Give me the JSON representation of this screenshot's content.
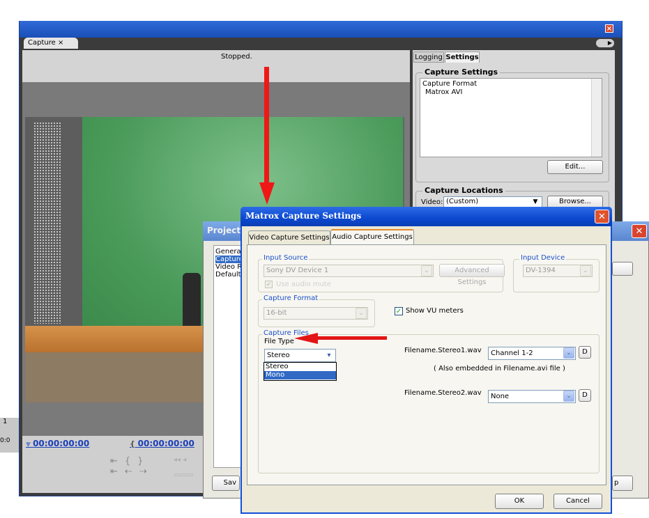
{
  "capture_panel": {
    "tab_label": "Capture",
    "tab_close": "×",
    "status": "Stopped.",
    "timecode_left": "00:00:00:00",
    "timecode_right": "00:00:00:00",
    "timecode_edge": "0:0",
    "edge_number": "1"
  },
  "settings_panel": {
    "tabs": [
      "Logging",
      "Settings"
    ],
    "capture_settings_title": "Capture Settings",
    "capture_format_label": "Capture Format",
    "capture_format_value": "Matrox AVI",
    "edit_button": "Edit...",
    "capture_locations_title": "Capture Locations",
    "video_label": "Video:",
    "video_value": "(Custom)",
    "browse_button": "Browse..."
  },
  "project_dialog": {
    "title": "Project",
    "list_items": [
      "General",
      "Capture",
      "Video R",
      "Default "
    ],
    "save_button": "Sav",
    "help_button": "p"
  },
  "matrox_dialog": {
    "title": "Matrox Capture Settings",
    "tabs": [
      "Video Capture Settings",
      "Audio Capture Settings"
    ],
    "input_source": {
      "label": "Input Source",
      "value": "Sony DV Device 1",
      "advanced_button": "Advanced Settings",
      "hidden_option": "Use audio mute"
    },
    "input_device": {
      "label": "Input Device",
      "value": "DV-1394"
    },
    "capture_format": {
      "label": "Capture Format",
      "value": "16-bit"
    },
    "show_vu": "Show VU meters",
    "capture_files": {
      "label": "Capture Files",
      "file_type_label": "File Type",
      "file_type_value": "Stereo",
      "options": [
        "Stereo",
        "Mono"
      ],
      "file1_name": "Filename.Stereo1.wav",
      "file1_channel": "Channel 1-2",
      "file1_note": "( Also embedded in Filename.avi file )",
      "file2_name": "Filename.Stereo2.wav",
      "file2_channel": "None",
      "d_button": "D"
    },
    "ok_button": "OK",
    "cancel_button": "Cancel",
    "close_glyph": "✕"
  },
  "colors": {
    "accent_red": "#f01717",
    "title_blue": "#0b48cf",
    "selection": "#316ac5"
  }
}
